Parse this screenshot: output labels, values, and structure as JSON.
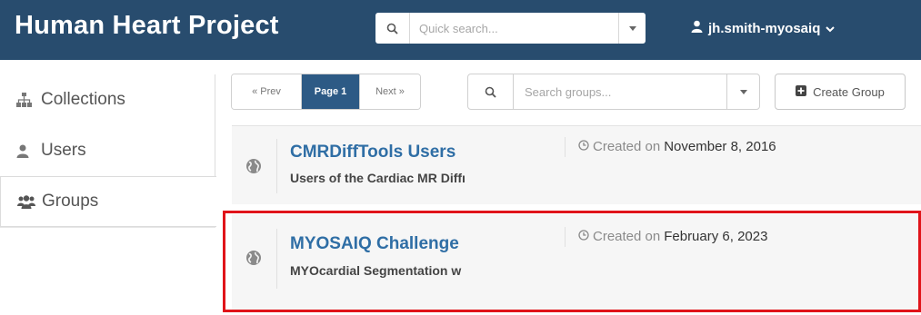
{
  "header": {
    "brand": "Human Heart Project",
    "search_placeholder": "Quick search...",
    "username": "jh.smith-myosaiq",
    "bg_color": "#284c6e"
  },
  "sidebar": {
    "items": [
      {
        "label": "Collections",
        "icon": "sitemap-icon",
        "active": false
      },
      {
        "label": "Users",
        "icon": "user-icon",
        "active": false
      },
      {
        "label": "Groups",
        "icon": "users-group-icon",
        "active": true
      }
    ]
  },
  "toolbar": {
    "prev_label": "« Prev",
    "page_label": "Page 1",
    "next_label": "Next »",
    "search_placeholder": "Search groups...",
    "create_label": "Create Group",
    "accent": "#2d5a85"
  },
  "groups": [
    {
      "name": "CMRDiffTools Users",
      "description": "Users of the Cardiac MR Diffı",
      "created_prefix": "Created on",
      "created_date": "November 8, 2016"
    },
    {
      "name": "MYOSAIQ Challenge",
      "description": "MYOcardial Segmentation w",
      "created_prefix": "Created on",
      "created_date": "February 6, 2023",
      "highlighted": true
    }
  ],
  "colors": {
    "link": "#2f6ea5",
    "highlight_border": "#e0141a"
  }
}
